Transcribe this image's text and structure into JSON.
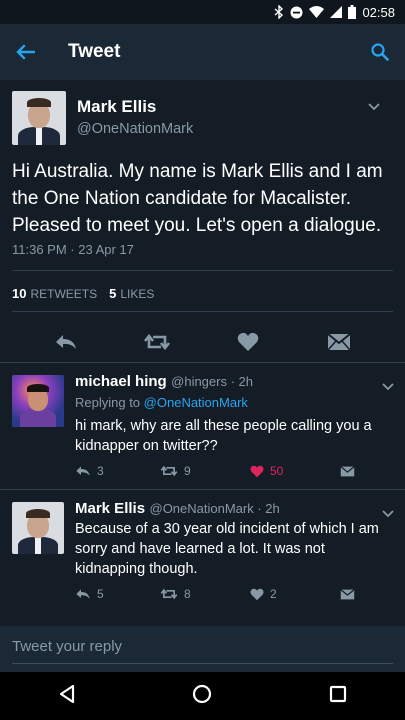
{
  "status_bar": {
    "time": "02:58",
    "icons": [
      "bluetooth-icon",
      "minus-circle-icon",
      "wifi-icon",
      "signal-icon",
      "battery-icon"
    ]
  },
  "app_bar": {
    "title": "Tweet"
  },
  "main_tweet": {
    "name": "Mark Ellis",
    "handle": "@OneNationMark",
    "text": "Hi Australia. My name is Mark Ellis and I am the One Nation candidate for Macalister. Pleased to meet you. Let's open a dialogue.",
    "timestamp": "11:36 PM · 23 Apr 17",
    "retweets_count": "10",
    "retweets_label": "RETWEETS",
    "likes_count": "5",
    "likes_label": "LIKES"
  },
  "replies": [
    {
      "name": "michael hing",
      "handle": "@hingers · 2h",
      "replying_prefix": "Replying to",
      "replying_to": "@OneNationMark",
      "text": "hi mark, why are all these people calling you a kidnapper on twitter??",
      "reply_count": "3",
      "retweet_count": "9",
      "like_count": "50"
    },
    {
      "name": "Mark Ellis",
      "handle": "@OneNationMark · 2h",
      "text": "Because of a 30 year old incident of which I am sorry and have learned a lot. It was not kidnapping though.",
      "reply_count": "5",
      "retweet_count": "8",
      "like_count": "2"
    }
  ],
  "reply_input": {
    "placeholder": "Tweet your reply"
  },
  "colors": {
    "accent": "#2aa3ef",
    "like": "#e0245e",
    "muted": "#8899a6",
    "background": "#141d26"
  }
}
